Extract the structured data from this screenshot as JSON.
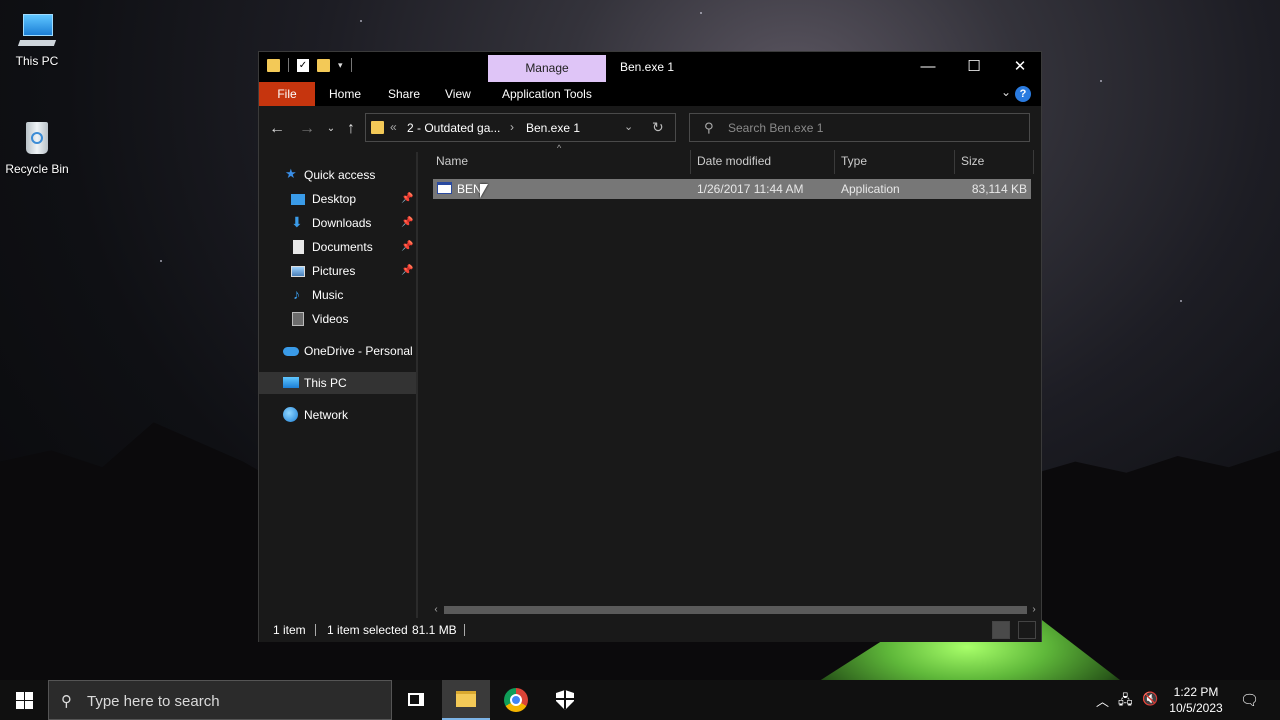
{
  "desktop": {
    "icons": [
      {
        "label": "This PC"
      },
      {
        "label": "Recycle Bin"
      }
    ]
  },
  "window": {
    "title": "Ben.exe 1",
    "contextual_tab": "Manage",
    "ribbon_tabs": {
      "file": "File",
      "home": "Home",
      "share": "Share",
      "view": "View",
      "app_tools": "Application Tools"
    },
    "address": {
      "segment_1": "2 - Outdated ga...",
      "segment_2": "Ben.exe 1"
    },
    "search": {
      "placeholder": "Search Ben.exe 1"
    },
    "nav": {
      "quick_access": "Quick access",
      "desktop": "Desktop",
      "downloads": "Downloads",
      "documents": "Documents",
      "pictures": "Pictures",
      "music": "Music",
      "videos": "Videos",
      "onedrive": "OneDrive - Personal",
      "this_pc": "This PC",
      "network": "Network"
    },
    "columns": {
      "name": "Name",
      "date": "Date modified",
      "type": "Type",
      "size": "Size"
    },
    "files": [
      {
        "name": "BEN",
        "date": "1/26/2017 11:44 AM",
        "type": "Application",
        "size": "83,114 KB"
      }
    ],
    "status": {
      "count": "1 item",
      "selected": "1 item selected",
      "size": "81.1 MB"
    }
  },
  "taskbar": {
    "search_placeholder": "Type here to search",
    "time": "1:22 PM",
    "date": "10/5/2023"
  },
  "colors": {
    "file_tab": "#c6350e",
    "manage_tab": "#dfc5f7",
    "selection": "#777777"
  }
}
